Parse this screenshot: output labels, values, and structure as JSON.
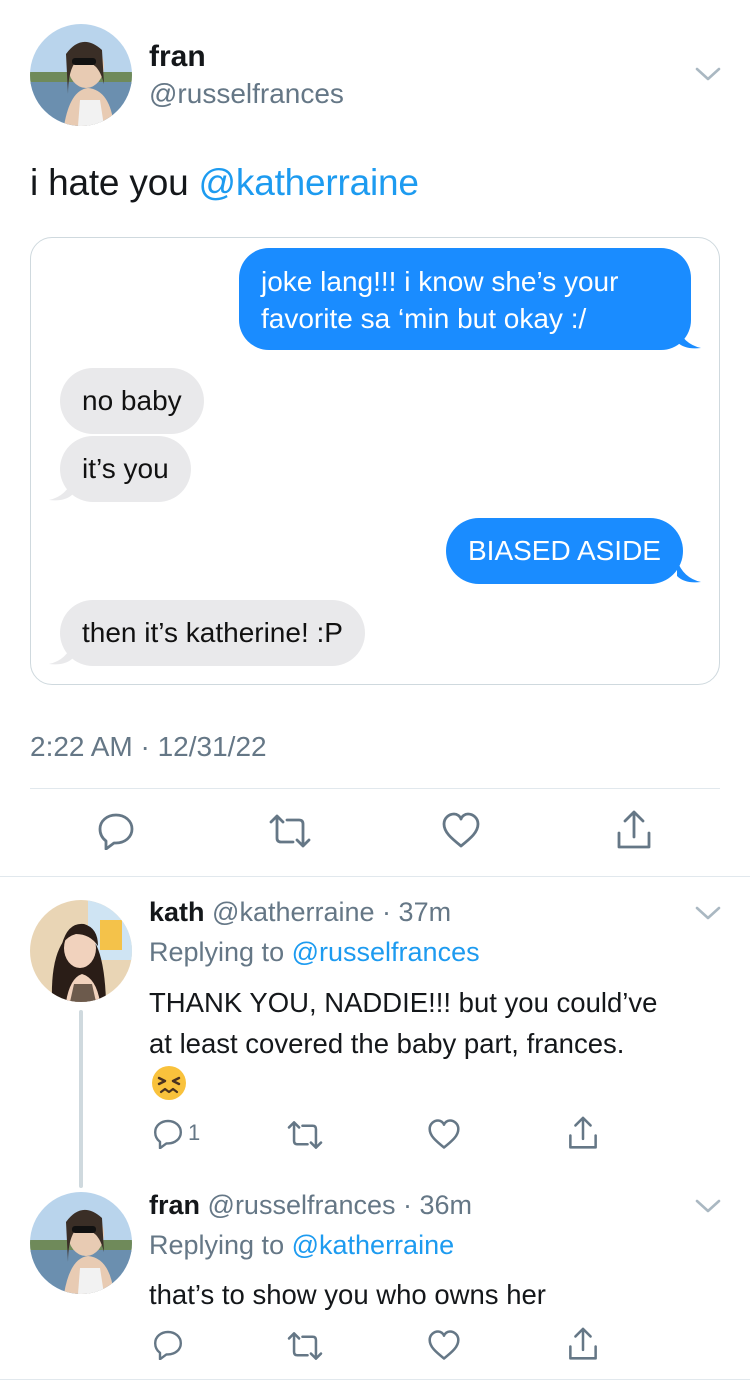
{
  "tweet": {
    "author_name": "fran",
    "author_handle": "@russelfrances",
    "text_prefix": "i hate you ",
    "text_mention": "@katherraine",
    "timestamp": "2:22 AM · 12/31/22"
  },
  "chat": {
    "messages": [
      {
        "side": "out",
        "lines": [
          "joke lang!!! i know she’s your",
          "favorite sa ‘min but okay :/"
        ]
      },
      {
        "side": "in",
        "lines": [
          "no baby"
        ]
      },
      {
        "side": "in",
        "lines": [
          "it’s you"
        ]
      },
      {
        "side": "out",
        "lines": [
          "BIASED ASIDE"
        ]
      },
      {
        "side": "in",
        "lines": [
          "then it’s katherine! :P"
        ]
      }
    ]
  },
  "replies": [
    {
      "name": "kath",
      "handle": "@katherraine",
      "time": "37m",
      "replying_label": "Replying to",
      "replying_to": "@russelfrances",
      "body_line1": "THANK YOU, NADDIE!!! but you could’ve",
      "body_line2": "at least covered the baby part, frances.",
      "emoji": "confounded-face",
      "reply_count": "1"
    },
    {
      "name": "fran",
      "handle": "@russelfrances",
      "time": "36m",
      "replying_label": "Replying to",
      "replying_to": "@katherraine",
      "body_line1": "that’s to show you who owns her",
      "reply_count": ""
    }
  ],
  "icons": {
    "reply": "reply-icon",
    "retweet": "retweet-icon",
    "like": "heart-icon",
    "share": "share-icon",
    "more": "chevron-down-icon"
  },
  "colors": {
    "accent": "#1d9bf0",
    "imessage_blue": "#1a8cff",
    "imessage_gray": "#e9e9eb",
    "secondary_text": "#657786"
  }
}
